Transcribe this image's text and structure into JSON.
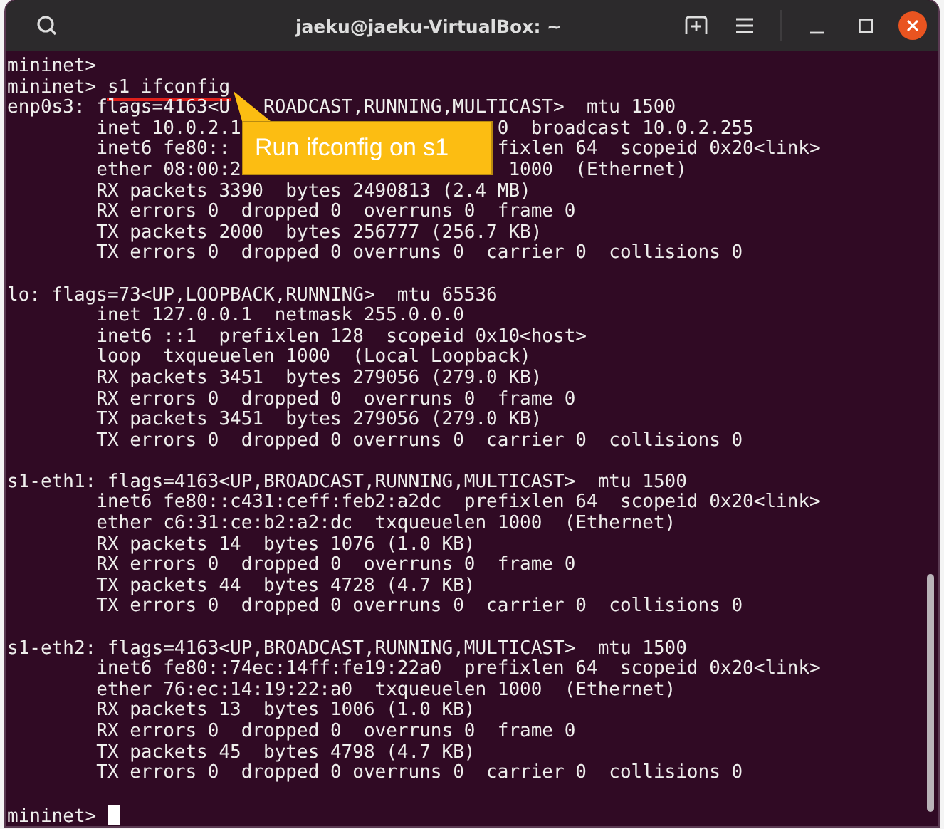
{
  "window": {
    "title": "jaeku@jaeku-VirtualBox: ~"
  },
  "terminal": {
    "lines": [
      {
        "kind": "output",
        "text": "mininet>"
      },
      {
        "kind": "command",
        "prompt": "mininet>",
        "command": "s1 ifconfig"
      },
      {
        "kind": "covered",
        "left": "enp0s3: flags=4163<U",
        "right": "ROADCAST,RUNNING,MULTICAST>  mtu 1500"
      },
      {
        "kind": "covered",
        "left": "        inet 10.0.2.1",
        "right": "0  broadcast 10.0.2.255"
      },
      {
        "kind": "covered",
        "left": "        inet6 fe80::",
        "right": "fixlen 64  scopeid 0x20<link>"
      },
      {
        "kind": "covered",
        "left": "        ether 08:00:2",
        "right": "1000  (Ethernet)"
      },
      {
        "kind": "output",
        "text": "        RX packets 3390  bytes 2490813 (2.4 MB)"
      },
      {
        "kind": "output",
        "text": "        RX errors 0  dropped 0  overruns 0  frame 0"
      },
      {
        "kind": "output",
        "text": "        TX packets 2000  bytes 256777 (256.7 KB)"
      },
      {
        "kind": "output",
        "text": "        TX errors 0  dropped 0 overruns 0  carrier 0  collisions 0"
      },
      {
        "kind": "blank"
      },
      {
        "kind": "output",
        "text": "lo: flags=73<UP,LOOPBACK,RUNNING>  mtu 65536"
      },
      {
        "kind": "output",
        "text": "        inet 127.0.0.1  netmask 255.0.0.0"
      },
      {
        "kind": "output",
        "text": "        inet6 ::1  prefixlen 128  scopeid 0x10<host>"
      },
      {
        "kind": "output",
        "text": "        loop  txqueuelen 1000  (Local Loopback)"
      },
      {
        "kind": "output",
        "text": "        RX packets 3451  bytes 279056 (279.0 KB)"
      },
      {
        "kind": "output",
        "text": "        RX errors 0  dropped 0  overruns 0  frame 0"
      },
      {
        "kind": "output",
        "text": "        TX packets 3451  bytes 279056 (279.0 KB)"
      },
      {
        "kind": "output",
        "text": "        TX errors 0  dropped 0 overruns 0  carrier 0  collisions 0"
      },
      {
        "kind": "blank"
      },
      {
        "kind": "output",
        "text": "s1-eth1: flags=4163<UP,BROADCAST,RUNNING,MULTICAST>  mtu 1500"
      },
      {
        "kind": "output",
        "text": "        inet6 fe80::c431:ceff:feb2:a2dc  prefixlen 64  scopeid 0x20<link>"
      },
      {
        "kind": "output",
        "text": "        ether c6:31:ce:b2:a2:dc  txqueuelen 1000  (Ethernet)"
      },
      {
        "kind": "output",
        "text": "        RX packets 14  bytes 1076 (1.0 KB)"
      },
      {
        "kind": "output",
        "text": "        RX errors 0  dropped 0  overruns 0  frame 0"
      },
      {
        "kind": "output",
        "text": "        TX packets 44  bytes 4728 (4.7 KB)"
      },
      {
        "kind": "output",
        "text": "        TX errors 0  dropped 0 overruns 0  carrier 0  collisions 0"
      },
      {
        "kind": "blank"
      },
      {
        "kind": "output",
        "text": "s1-eth2: flags=4163<UP,BROADCAST,RUNNING,MULTICAST>  mtu 1500"
      },
      {
        "kind": "output",
        "text": "        inet6 fe80::74ec:14ff:fe19:22a0  prefixlen 64  scopeid 0x20<link>"
      },
      {
        "kind": "output",
        "text": "        ether 76:ec:14:19:22:a0  txqueuelen 1000  (Ethernet)"
      },
      {
        "kind": "output",
        "text": "        RX packets 13  bytes 1006 (1.0 KB)"
      },
      {
        "kind": "output",
        "text": "        RX errors 0  dropped 0  overruns 0  frame 0"
      },
      {
        "kind": "output",
        "text": "        TX packets 45  bytes 4798 (4.7 KB)"
      },
      {
        "kind": "output",
        "text": "        TX errors 0  dropped 0 overruns 0  carrier 0  collisions 0"
      },
      {
        "kind": "blank"
      },
      {
        "kind": "prompt",
        "prompt": "mininet>",
        "cursor": true
      }
    ]
  },
  "callout": {
    "text": "Run ifconfig on s1"
  }
}
